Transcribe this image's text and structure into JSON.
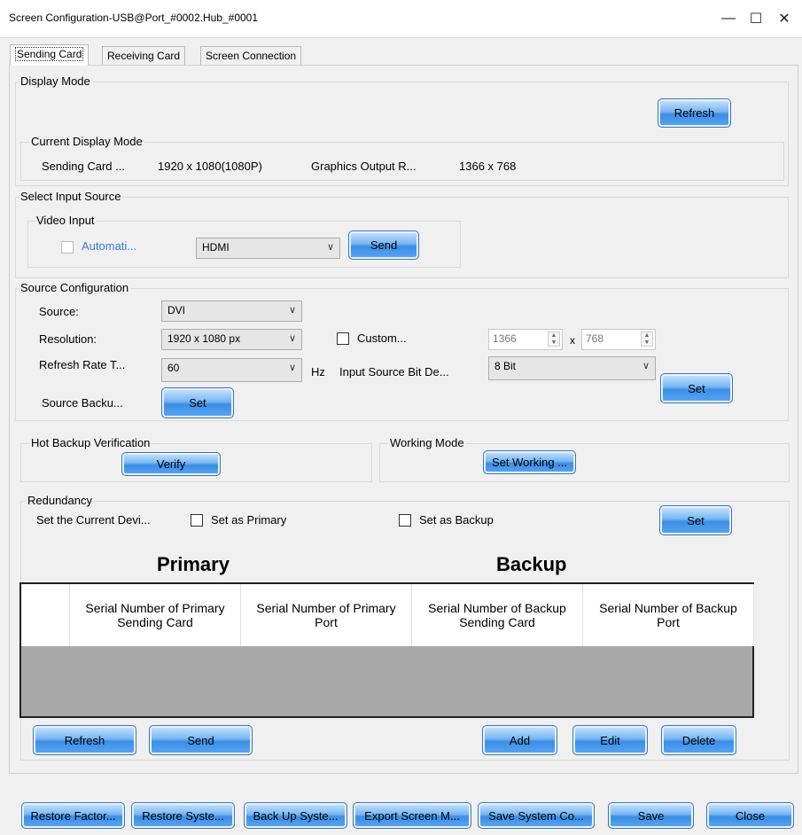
{
  "window": {
    "title": "Screen Configuration-USB@Port_#0002.Hub_#0001",
    "minimize": "—",
    "maximize": "☐",
    "close": "✕"
  },
  "tabs": [
    "Sending Card",
    "Receiving Card",
    "Screen Connection"
  ],
  "display_mode": {
    "group": "Display Mode",
    "refresh": "Refresh",
    "current_group": "Current Display Mode",
    "sending_card_label": "Sending Card ...",
    "sending_card_value": "1920 x 1080(1080P)",
    "graphics_label": "Graphics Output R...",
    "graphics_value": "1366 x 768"
  },
  "input_source": {
    "group": "Select Input Source",
    "video_group": "Video Input",
    "automatic": "Automati...",
    "selected": "HDMI",
    "send": "Send"
  },
  "source_config": {
    "group": "Source Configuration",
    "source_label": "Source:",
    "source_value": "DVI",
    "resolution_label": "Resolution:",
    "resolution_value": "1920 x 1080 px",
    "custom_label": "Custom...",
    "width_value": "1366",
    "x_sep": "x",
    "height_value": "768",
    "refresh_label": "Refresh Rate T...",
    "refresh_value": "60",
    "hz": "Hz",
    "bit_depth_label": "Input Source Bit De...",
    "bit_depth_value": "8 Bit",
    "set": "Set",
    "backup_label": "Source Backu...",
    "backup_set": "Set"
  },
  "hot_backup": {
    "group": "Hot Backup Verification",
    "verify": "Verify"
  },
  "working_mode": {
    "group": "Working Mode",
    "button": "Set Working ..."
  },
  "redundancy": {
    "group": "Redundancy",
    "set_current_label": "Set the Current Devi...",
    "primary_chk": "Set as Primary",
    "backup_chk": "Set as Backup",
    "set": "Set",
    "primary_title": "Primary",
    "backup_title": "Backup",
    "columns": [
      "Serial Number of Primary Sending Card",
      "Serial Number of Primary Port",
      "Serial Number of Backup Sending Card",
      "Serial Number of Backup Port"
    ],
    "refresh": "Refresh",
    "send": "Send",
    "add": "Add",
    "edit": "Edit",
    "delete": "Delete"
  },
  "footer": {
    "restore_factory": "Restore Factor...",
    "restore_system": "Restore Syste...",
    "back_up_system": "Back Up Syste...",
    "export_screen": "Export Screen M...",
    "save_system": "Save System Co...",
    "save": "Save",
    "close": "Close"
  }
}
